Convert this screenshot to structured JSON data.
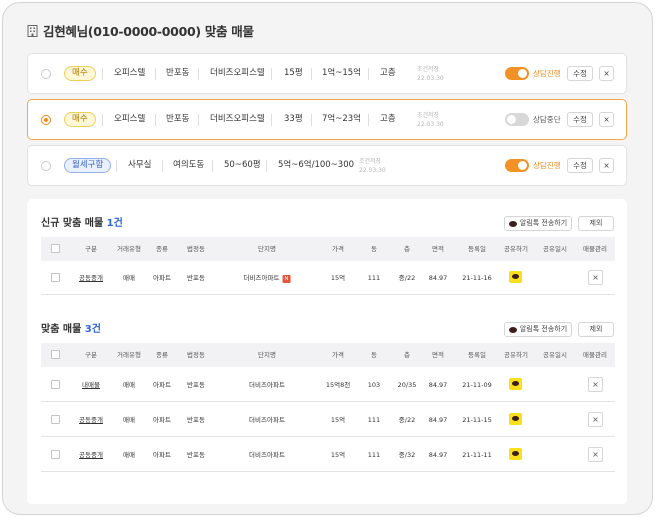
{
  "header": {
    "title": "김현혜님(010-0000-0000) 맞춤 매물"
  },
  "conditions": [
    {
      "tag": "매수",
      "kind": "buy",
      "type": "오피스텔",
      "dong": "반포동",
      "complex": "더비즈오피스텔",
      "size": "15평",
      "price": "1억~15억",
      "floor": "고층",
      "saved_label": "조건저장",
      "saved_date": "22.03.30",
      "toggle_label": "상담진행",
      "toggle_on": true,
      "edit_label": "수정",
      "delete_label": "×",
      "selected": false
    },
    {
      "tag": "매수",
      "kind": "buy",
      "type": "오피스텔",
      "dong": "반포동",
      "complex": "더비즈오피스텔",
      "size": "33평",
      "price": "7억~23억",
      "floor": "고층",
      "saved_label": "조건저장",
      "saved_date": "22.03.30",
      "toggle_label": "상담중단",
      "toggle_on": false,
      "edit_label": "수정",
      "delete_label": "×",
      "selected": true
    },
    {
      "tag": "월세구함",
      "kind": "rent",
      "type": "사무실",
      "dong": "여의도동",
      "size": "50~60평",
      "price": "5억~6억/100~300",
      "saved_label": "조건저장",
      "saved_date": "22.03.30",
      "toggle_label": "상담진행",
      "toggle_on": true,
      "edit_label": "수정",
      "delete_label": "×",
      "selected": false
    }
  ],
  "new_section": {
    "title": "신규 맞춤 매물",
    "count": "1건",
    "send_label": "알림톡 전송하기",
    "exclude_label": "제외",
    "columns": [
      "구분",
      "거래유형",
      "종류",
      "법정동",
      "단지명",
      "가격",
      "동",
      "층",
      "면적",
      "등록일",
      "공유하기",
      "공유일시",
      "매물관리"
    ],
    "rows": [
      {
        "kind": "공동중개",
        "deal": "매매",
        "type": "아파트",
        "dong": "반포동",
        "complex": "더비즈아파트",
        "badge": "N",
        "price": "15억",
        "bldg": "111",
        "floor": "중/22",
        "area": "84.97",
        "date": "21-11-16"
      }
    ]
  },
  "match_section": {
    "title": "맞춤 매물",
    "count": "3건",
    "send_label": "알림톡 전송하기",
    "exclude_label": "제외",
    "columns": [
      "구분",
      "거래유형",
      "종류",
      "법정동",
      "단지명",
      "가격",
      "동",
      "층",
      "면적",
      "등록일",
      "공유하기",
      "공유일시",
      "매물관리"
    ],
    "rows": [
      {
        "kind": "내매물",
        "deal": "매매",
        "type": "아파트",
        "dong": "반포동",
        "complex": "더비즈아파트",
        "price": "15억8천",
        "bldg": "103",
        "floor": "20/35",
        "area": "84.97",
        "date": "21-11-09"
      },
      {
        "kind": "공동중개",
        "deal": "매매",
        "type": "아파트",
        "dong": "반포동",
        "complex": "더비즈아파트",
        "price": "15억",
        "bldg": "111",
        "floor": "중/22",
        "area": "84.97",
        "date": "21-11-15"
      },
      {
        "kind": "공동중개",
        "deal": "매매",
        "type": "아파트",
        "dong": "반포동",
        "complex": "더비즈아파트",
        "price": "15억",
        "bldg": "111",
        "floor": "중/32",
        "area": "84.97",
        "date": "21-11-11"
      }
    ]
  },
  "colors": {
    "accent": "#f29226",
    "link_blue": "#2f66d6",
    "kakao": "#f9df1c"
  },
  "icons": {
    "title": "building-icon",
    "share": "kakaotalk-icon",
    "delete": "close-icon"
  }
}
